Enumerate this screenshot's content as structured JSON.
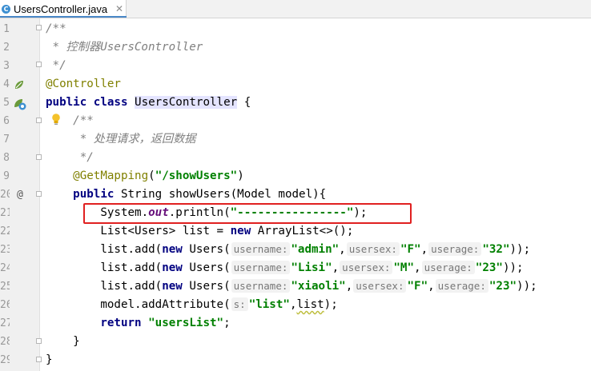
{
  "tab": {
    "title": "UsersController.java",
    "icon": "java-class-icon",
    "close": "✕"
  },
  "gutter": {
    "override_marker": "@"
  },
  "lines": [
    {
      "n": "1",
      "segments": [
        {
          "t": "/**",
          "c": "cmt"
        }
      ]
    },
    {
      "n": "2",
      "segments": [
        {
          "t": " * 控制器UsersController",
          "c": "cmt"
        }
      ]
    },
    {
      "n": "3",
      "segments": [
        {
          "t": " */",
          "c": "cmt"
        }
      ]
    },
    {
      "n": "4",
      "segments": [
        {
          "t": "@Controller",
          "c": "ann"
        }
      ]
    },
    {
      "n": "5",
      "segments": [
        {
          "t": "public class ",
          "c": "kw"
        },
        {
          "t": "UsersController",
          "c": "hl"
        },
        {
          "t": " {",
          "c": ""
        }
      ]
    },
    {
      "n": "6",
      "segments": [
        {
          "t": "    /**",
          "c": "cmt"
        }
      ]
    },
    {
      "n": "7",
      "segments": [
        {
          "t": "     * 处理请求，返回数据",
          "c": "cmt"
        }
      ]
    },
    {
      "n": "8",
      "segments": [
        {
          "t": "     */",
          "c": "cmt"
        }
      ]
    },
    {
      "n": "9",
      "segments": [
        {
          "t": "    ",
          "c": ""
        },
        {
          "t": "@GetMapping",
          "c": "ann"
        },
        {
          "t": "(",
          "c": ""
        },
        {
          "t": "\"/showUsers\"",
          "c": "str"
        },
        {
          "t": ")",
          "c": ""
        }
      ]
    },
    {
      "n": "20",
      "segments": [
        {
          "t": "    ",
          "c": ""
        },
        {
          "t": "public ",
          "c": "kw"
        },
        {
          "t": "String showUsers(Model model){",
          "c": ""
        }
      ]
    },
    {
      "n": "21",
      "segments": [
        {
          "t": "        System.",
          "c": ""
        },
        {
          "t": "out",
          "c": "fld"
        },
        {
          "t": ".println(",
          "c": ""
        },
        {
          "t": "\"----------------\"",
          "c": "str"
        },
        {
          "t": ");",
          "c": ""
        }
      ]
    },
    {
      "n": "22",
      "segments": [
        {
          "t": "        List<Users> list = ",
          "c": ""
        },
        {
          "t": "new ",
          "c": "kw"
        },
        {
          "t": "ArrayList<>();",
          "c": ""
        }
      ]
    },
    {
      "n": "23",
      "segments": [
        {
          "t": "        list.add(",
          "c": ""
        },
        {
          "t": "new ",
          "c": "kw"
        },
        {
          "t": "Users(",
          "c": ""
        },
        {
          "t": "username:",
          "c": "hint"
        },
        {
          "t": "\"admin\"",
          "c": "str"
        },
        {
          "t": ",",
          "c": ""
        },
        {
          "t": "usersex:",
          "c": "hint"
        },
        {
          "t": "\"F\"",
          "c": "str"
        },
        {
          "t": ",",
          "c": ""
        },
        {
          "t": "userage:",
          "c": "hint"
        },
        {
          "t": "\"32\"",
          "c": "str"
        },
        {
          "t": "));",
          "c": ""
        }
      ]
    },
    {
      "n": "24",
      "segments": [
        {
          "t": "        list.add(",
          "c": ""
        },
        {
          "t": "new ",
          "c": "kw"
        },
        {
          "t": "Users(",
          "c": ""
        },
        {
          "t": "username:",
          "c": "hint"
        },
        {
          "t": "\"Lisi\"",
          "c": "str"
        },
        {
          "t": ",",
          "c": ""
        },
        {
          "t": "usersex:",
          "c": "hint"
        },
        {
          "t": "\"M\"",
          "c": "str"
        },
        {
          "t": ",",
          "c": ""
        },
        {
          "t": "userage:",
          "c": "hint"
        },
        {
          "t": "\"23\"",
          "c": "str"
        },
        {
          "t": "));",
          "c": ""
        }
      ]
    },
    {
      "n": "25",
      "segments": [
        {
          "t": "        list.add(",
          "c": ""
        },
        {
          "t": "new ",
          "c": "kw"
        },
        {
          "t": "Users(",
          "c": ""
        },
        {
          "t": "username:",
          "c": "hint"
        },
        {
          "t": "\"xiaoli\"",
          "c": "str"
        },
        {
          "t": ",",
          "c": ""
        },
        {
          "t": "usersex:",
          "c": "hint"
        },
        {
          "t": "\"F\"",
          "c": "str"
        },
        {
          "t": ",",
          "c": ""
        },
        {
          "t": "userage:",
          "c": "hint"
        },
        {
          "t": "\"23\"",
          "c": "str"
        },
        {
          "t": "));",
          "c": ""
        }
      ]
    },
    {
      "n": "26",
      "segments": [
        {
          "t": "        model.addAttribute(",
          "c": ""
        },
        {
          "t": "s:",
          "c": "hint"
        },
        {
          "t": "\"list\"",
          "c": "str"
        },
        {
          "t": ",",
          "c": ""
        },
        {
          "t": "list",
          "c": "squig"
        },
        {
          "t": ");",
          "c": ""
        }
      ]
    },
    {
      "n": "27",
      "segments": [
        {
          "t": "        ",
          "c": ""
        },
        {
          "t": "return ",
          "c": "kw"
        },
        {
          "t": "\"usersList\"",
          "c": "str"
        },
        {
          "t": ";",
          "c": ""
        }
      ]
    },
    {
      "n": "28",
      "segments": [
        {
          "t": "    }",
          "c": ""
        }
      ]
    },
    {
      "n": "29",
      "segments": [
        {
          "t": "}",
          "c": ""
        }
      ]
    }
  ],
  "colors": {
    "keyword": "#000080",
    "string": "#008000",
    "comment": "#808080",
    "annotation": "#808000",
    "highlight_box": "#e02020"
  }
}
